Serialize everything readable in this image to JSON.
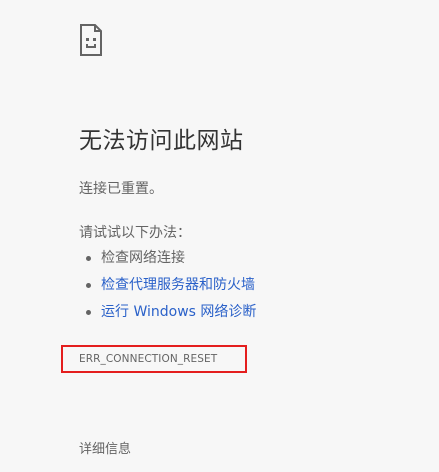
{
  "error": {
    "icon": "sad-page-icon",
    "title": "无法访问此网站",
    "summary": "连接已重置。",
    "suggestions_heading": "请试试以下办法：",
    "suggestions": [
      {
        "text": "检查网络连接",
        "link": false
      },
      {
        "text": "检查代理服务器和防火墙",
        "link": true
      },
      {
        "text": "运行 Windows 网络诊断",
        "link": true
      }
    ],
    "code": "ERR_CONNECTION_RESET",
    "details_label": "详细信息"
  },
  "colors": {
    "background": "#f7f7f7",
    "text": "#646464",
    "title": "#333333",
    "link": "#2a61c9",
    "highlight_box": "#e41e1e"
  }
}
